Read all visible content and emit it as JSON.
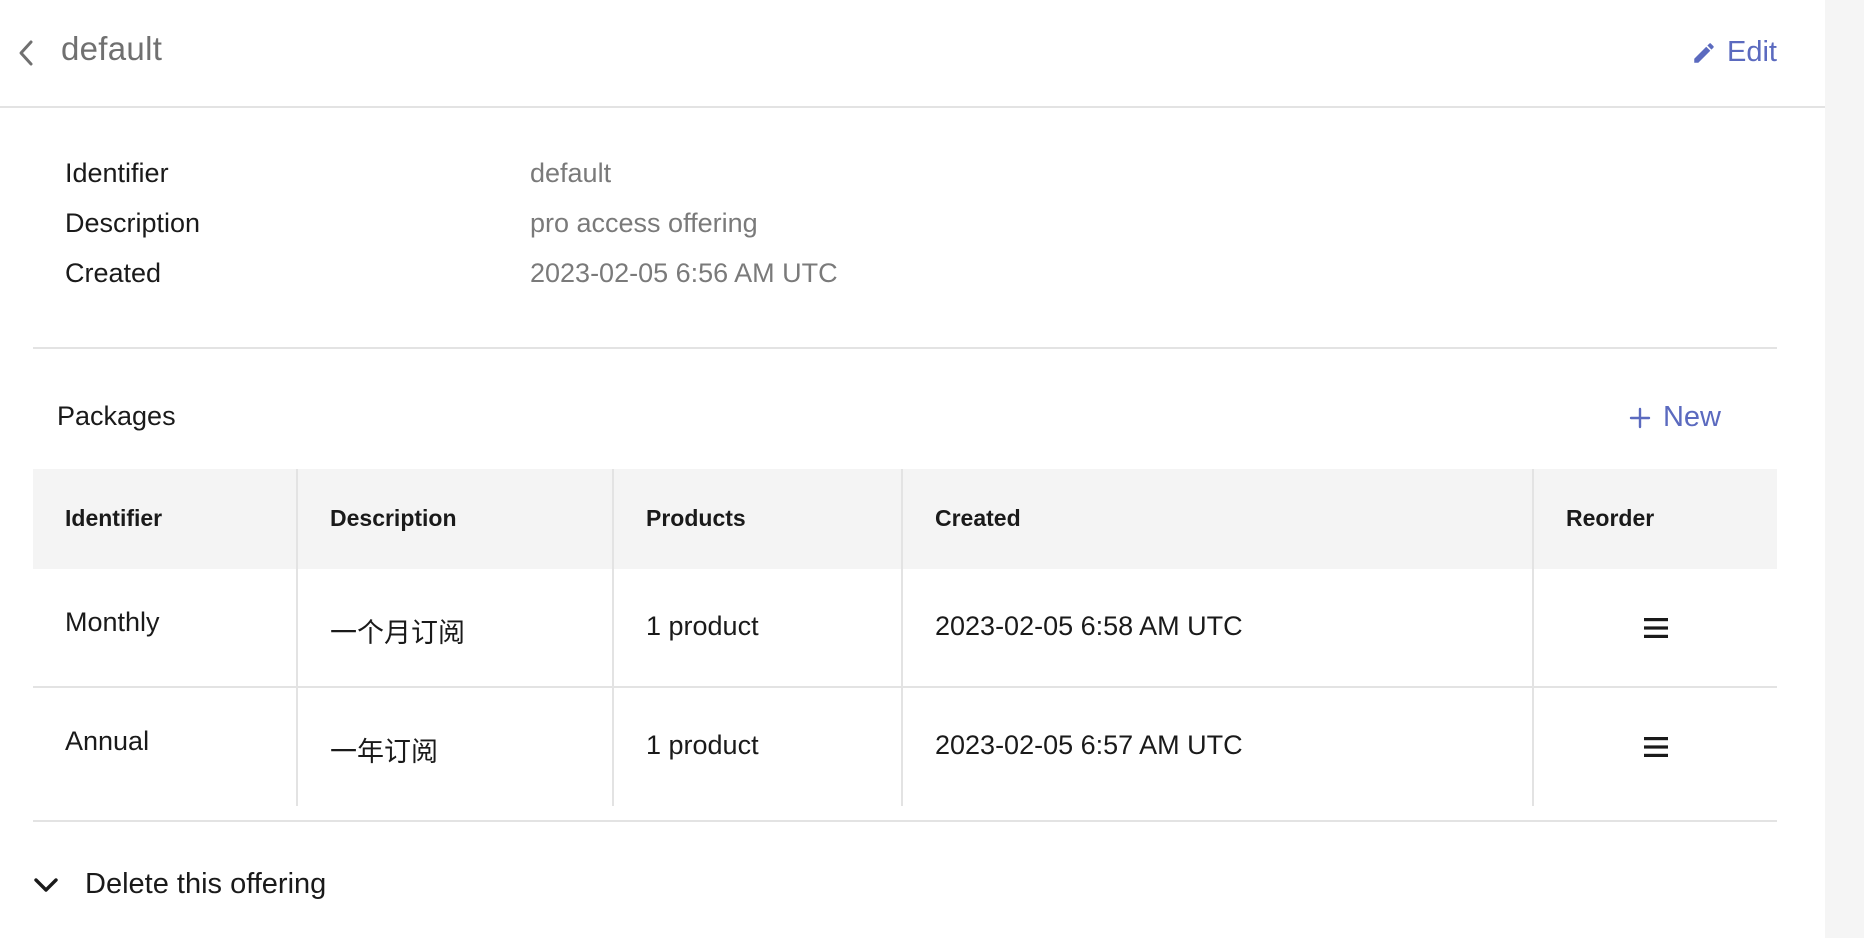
{
  "header": {
    "title": "default",
    "edit_label": "Edit",
    "back_icon": "chevron-left-icon",
    "edit_icon": "pencil-icon"
  },
  "details": [
    {
      "label": "Identifier",
      "value": "default"
    },
    {
      "label": "Description",
      "value": "pro access offering"
    },
    {
      "label": "Created",
      "value": "2023-02-05 6:56 AM UTC"
    }
  ],
  "packages": {
    "title": "Packages",
    "new_label": "New",
    "columns": [
      "Identifier",
      "Description",
      "Products",
      "Created",
      "Reorder"
    ],
    "rows": [
      {
        "identifier": "Monthly",
        "description": "一个月订阅",
        "products": "1 product",
        "created": "2023-02-05 6:58 AM UTC"
      },
      {
        "identifier": "Annual",
        "description": "一年订阅",
        "products": "1 product",
        "created": "2023-02-05 6:57 AM UTC"
      }
    ]
  },
  "delete_section": {
    "label": "Delete this offering",
    "icon": "chevron-down-icon"
  },
  "colors": {
    "accent": "#5b6abf",
    "muted_text": "#7a7a7a",
    "border": "#e3e3e3",
    "table_header_bg": "#f4f4f4"
  }
}
